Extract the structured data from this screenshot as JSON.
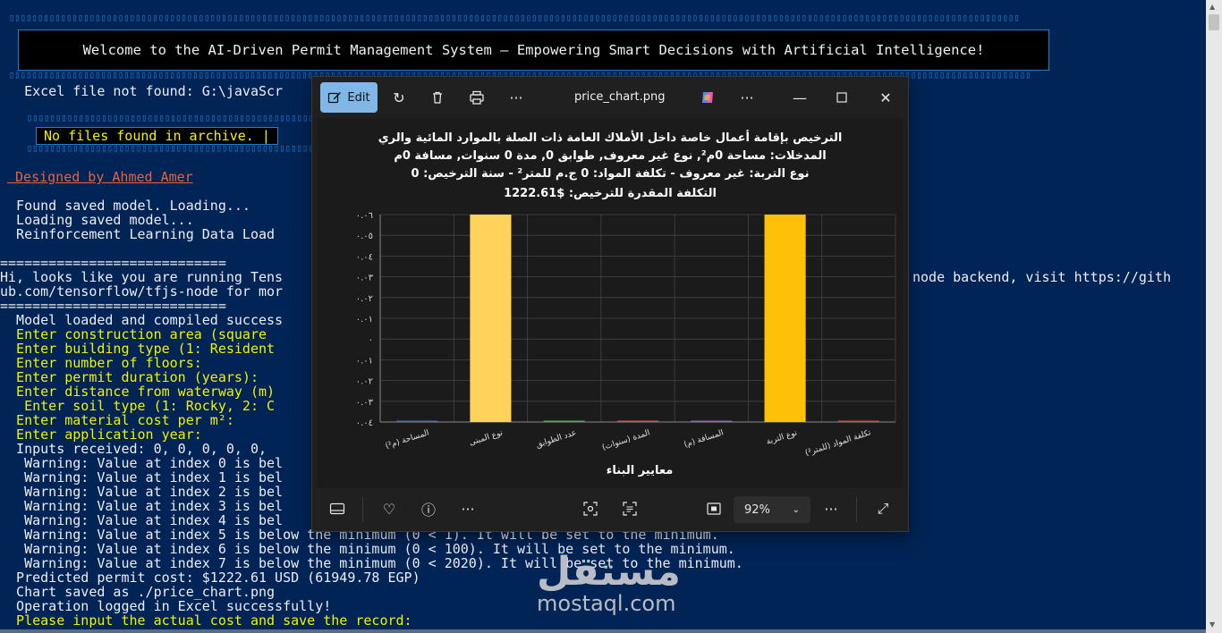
{
  "terminal": {
    "banner": "Welcome to the AI-Driven Permit Management System – Empowering Smart Decisions with Artificial Intelligence!",
    "excel_not_found": "   Excel file not found: G:\\javaScr",
    "no_files": "No files found in archive. |",
    "designed_by": " Designed by Ahmed Amer",
    "lines": [
      {
        "text": "  Found saved model. Loading...",
        "cls": ""
      },
      {
        "text": "  Loading saved model...",
        "cls": ""
      },
      {
        "text": "  Reinforcement Learning Data Load",
        "cls": ""
      },
      {
        "text": "============================",
        "cls": ""
      },
      {
        "text": "Hi, looks like you are running Tens",
        "cls": ""
      },
      {
        "text": "ub.com/tensorflow/tfjs-node for mor",
        "cls": ""
      },
      {
        "text": "============================",
        "cls": ""
      },
      {
        "text": "  Model loaded and compiled success",
        "cls": ""
      },
      {
        "text": "  Enter construction area (square",
        "cls": "y"
      },
      {
        "text": "  Enter building type (1: Resident",
        "cls": "y"
      },
      {
        "text": "  Enter number of floors:",
        "cls": "y"
      },
      {
        "text": "  Enter permit duration (years):",
        "cls": "y"
      },
      {
        "text": "  Enter distance from waterway (m)",
        "cls": "y"
      },
      {
        "text": "   Enter soil type (1: Rocky, 2: C",
        "cls": "y"
      },
      {
        "text": "  Enter material cost per m²:",
        "cls": "y"
      },
      {
        "text": "  Enter application year:",
        "cls": "y"
      },
      {
        "text": "  Inputs received: 0, 0, 0, 0, 0,",
        "cls": ""
      },
      {
        "text": "   Warning: Value at index 0 is bel",
        "cls": ""
      },
      {
        "text": "   Warning: Value at index 1 is bel",
        "cls": ""
      },
      {
        "text": "   Warning: Value at index 2 is bel",
        "cls": ""
      },
      {
        "text": "   Warning: Value at index 3 is bel",
        "cls": ""
      },
      {
        "text": "   Warning: Value at index 4 is bel",
        "cls": ""
      },
      {
        "text": "   Warning: Value at index 5 is below the minimum (0 < 1). It will be set to the minimum.",
        "cls": ""
      },
      {
        "text": "   Warning: Value at index 6 is below the minimum (0 < 100). It will be set to the minimum.",
        "cls": ""
      },
      {
        "text": "   Warning: Value at index 7 is below the minimum (0 < 2020). It will be set to the minimum.",
        "cls": ""
      },
      {
        "text": "  Predicted permit cost: $1222.61 USD (61949.78 EGP)",
        "cls": ""
      },
      {
        "text": "  Chart saved as ./price_chart.png",
        "cls": ""
      },
      {
        "text": "  Operation logged in Excel successfully!",
        "cls": ""
      },
      {
        "text": "  Please input the actual cost and save the record:",
        "cls": "y"
      }
    ],
    "tf_right_1": "node backend, visit https://gith"
  },
  "viewer": {
    "edit_label": "Edit",
    "filename": "price_chart.png",
    "zoom": "92%"
  },
  "chart_data": {
    "type": "bar",
    "title_lines": [
      "الترخيص بإقامة أعمال خاصة داخل الأملاك العامة ذات الصلة بالموارد المائية والري",
      "المدخلات: مساحة 0م², نوع غير معروف, طوابق 0, مدة 0 سنوات, مسافة 0م",
      "نوع التربة: غير معروف - تكلفة المواد: 0 ج.م للمتر² - سنة الترخيص: 0",
      "التكلفة المقدرة للترخيص: $1222.61"
    ],
    "xlabel": "معايير البناء",
    "ylabel": "",
    "categories": [
      "المساحة (م²)",
      "نوع المبنى",
      "عدد الطوابق",
      "المدة (سنوات)",
      "المسافة (م)",
      "نوع التربة",
      "تكلفة المواد (للمتر²)"
    ],
    "values": [
      0,
      1,
      0,
      0,
      0,
      1,
      0
    ],
    "bar_colors": [
      "#4d6fbf",
      "#ffd25a",
      "#4caf50",
      "#e05050",
      "#9c5fbf",
      "#ffc107",
      "#e04a3a"
    ],
    "ytick_labels": [
      "٠.٠٤",
      "٠.٠٣",
      "٠.٠٢",
      "٠.٠١",
      "٠",
      "٠.٠١",
      "٠.٠٢",
      "٠.٠٣",
      "٠.٠٤",
      "٠.٠٥",
      "٠.٠٦"
    ],
    "grid": true
  },
  "watermark": {
    "arabic": "مستقل",
    "latin": "mostaql.com"
  }
}
